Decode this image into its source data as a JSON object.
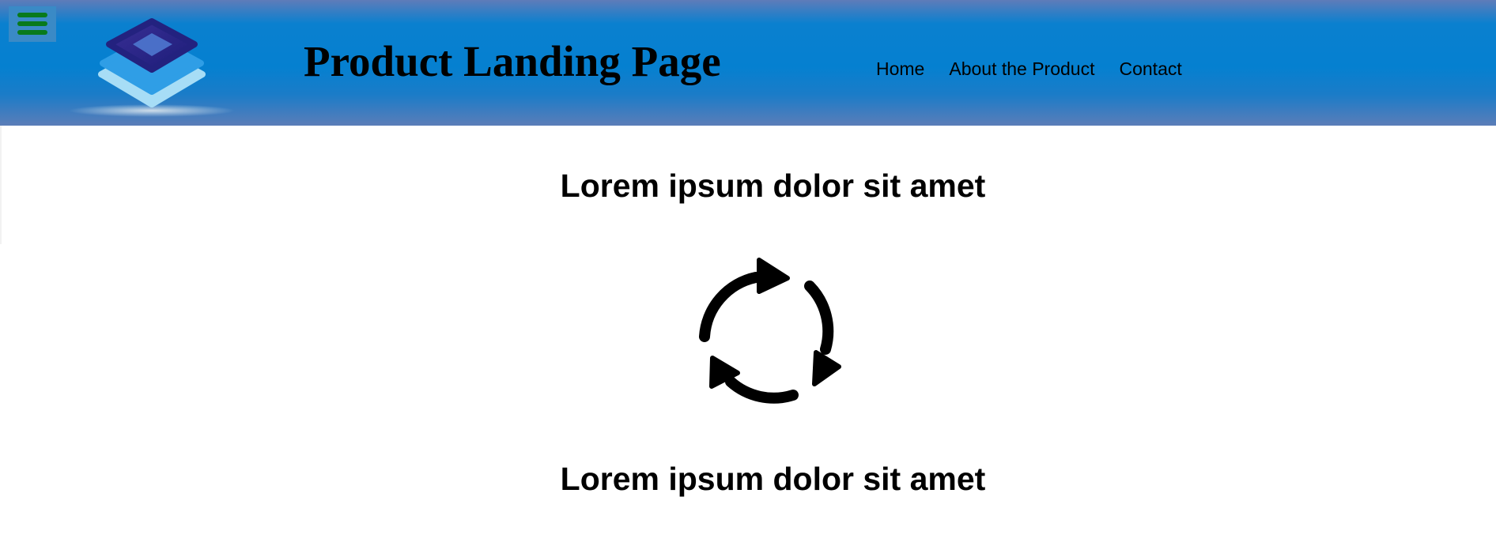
{
  "header": {
    "menu_icon": "hamburger-menu-icon",
    "logo_icon": "stacked-layers-logo-icon",
    "title": "Product Landing Page",
    "nav": [
      {
        "label": "Home"
      },
      {
        "label": "About the Product"
      },
      {
        "label": "Contact"
      }
    ],
    "colors": {
      "header_blue": "#0580d0",
      "header_edge": "#5e7cb9",
      "menu_bar_green": "#087a1c"
    }
  },
  "main": {
    "headings": [
      "Lorem ipsum dolor sit amet",
      "Lorem ipsum dolor sit amet"
    ],
    "cycle_icon": "recycle-arrows-icon"
  }
}
